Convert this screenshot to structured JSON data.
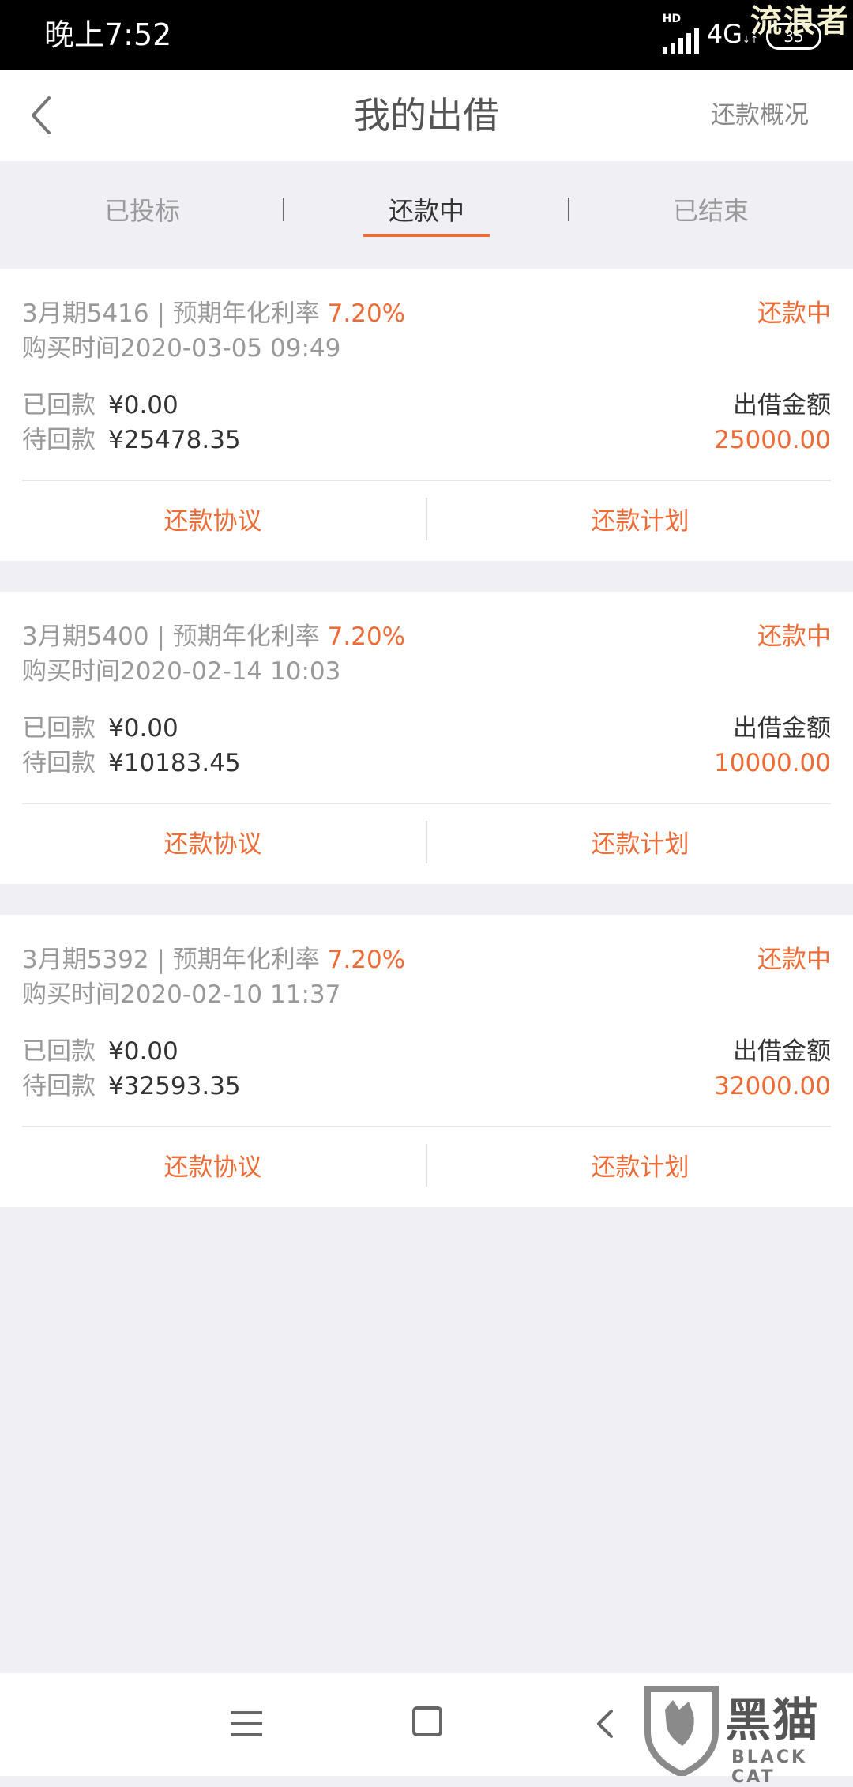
{
  "status_bar": {
    "time": "晚上7:52",
    "hd": "HD",
    "network": "4G",
    "network_sup": "↓↑",
    "battery": "35",
    "watermark": "流浪者"
  },
  "header": {
    "title": "我的出借",
    "action": "还款概况"
  },
  "tabs": [
    {
      "label": "已投标",
      "active": false
    },
    {
      "label": "还款中",
      "active": true
    },
    {
      "label": "已结束",
      "active": false
    }
  ],
  "tab_separator": "|",
  "cards": [
    {
      "product": "3月期5416",
      "separator": " | ",
      "rate_label": "预期年化利率",
      "rate": "7.20%",
      "status": "还款中",
      "purchase_label": "购买时间",
      "purchase_time": "2020-03-05 09:49",
      "received_label": "已回款",
      "received": "¥0.00",
      "pending_label": "待回款",
      "pending": "¥25478.35",
      "amount_label": "出借金额",
      "amount": "25000.00",
      "btn_agreement": "还款协议",
      "btn_plan": "还款计划"
    },
    {
      "product": "3月期5400",
      "separator": " | ",
      "rate_label": "预期年化利率",
      "rate": "7.20%",
      "status": "还款中",
      "purchase_label": "购买时间",
      "purchase_time": "2020-02-14 10:03",
      "received_label": "已回款",
      "received": "¥0.00",
      "pending_label": "待回款",
      "pending": "¥10183.45",
      "amount_label": "出借金额",
      "amount": "10000.00",
      "btn_agreement": "还款协议",
      "btn_plan": "还款计划"
    },
    {
      "product": "3月期5392",
      "separator": " | ",
      "rate_label": "预期年化利率",
      "rate": "7.20%",
      "status": "还款中",
      "purchase_label": "购买时间",
      "purchase_time": "2020-02-10 11:37",
      "received_label": "已回款",
      "received": "¥0.00",
      "pending_label": "待回款",
      "pending": "¥32593.35",
      "amount_label": "出借金额",
      "amount": "32000.00",
      "btn_agreement": "还款协议",
      "btn_plan": "还款计划"
    }
  ],
  "watermark_logo": {
    "text": "黑猫",
    "sub": "BLACK CAT"
  },
  "colors": {
    "accent": "#ee6b35",
    "background": "#efeff4"
  }
}
